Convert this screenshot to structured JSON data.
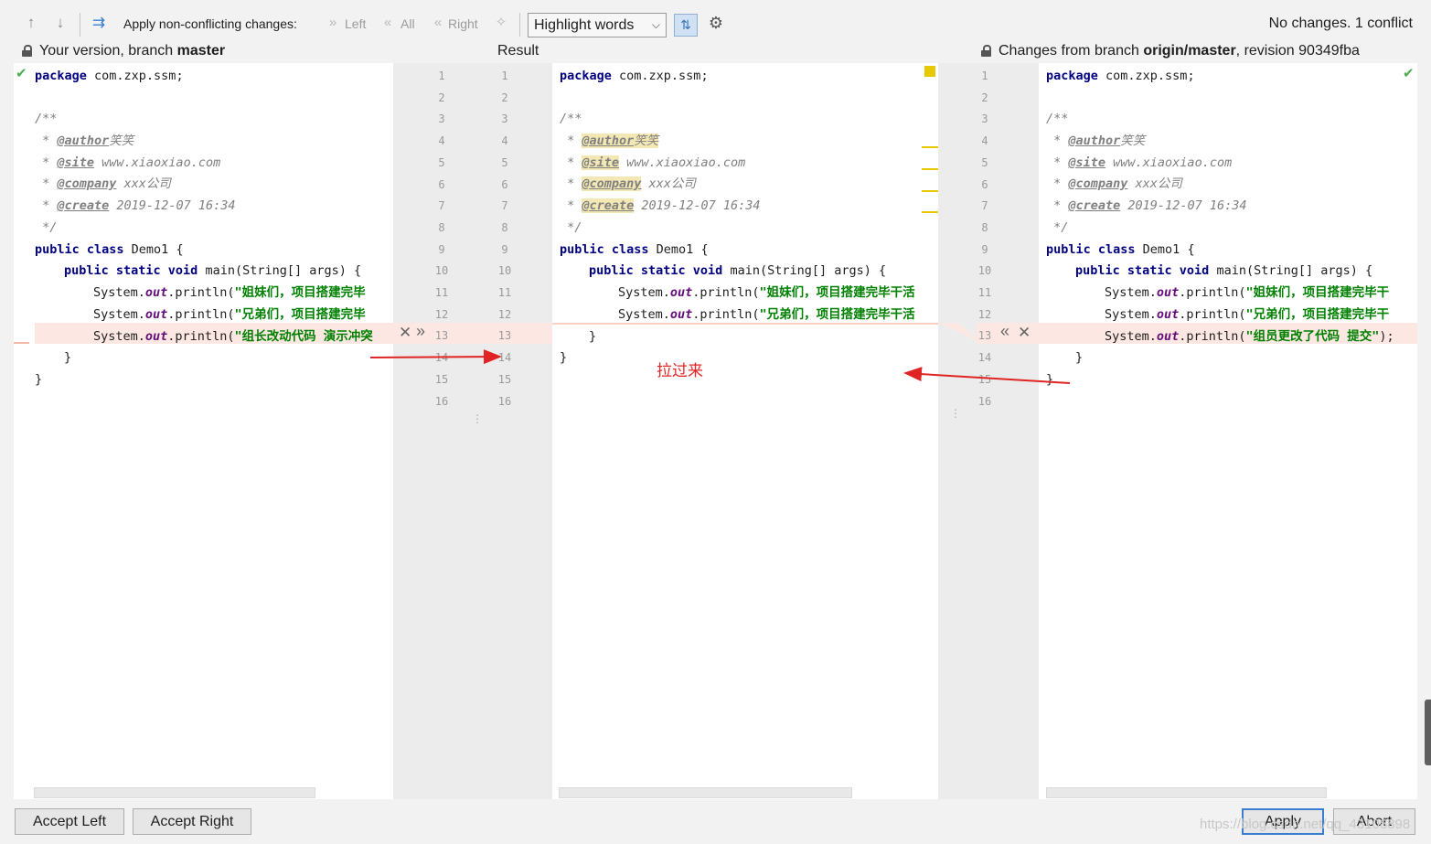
{
  "toolbar": {
    "apply_label": "Apply non-conflicting changes:",
    "left_label": "Left",
    "all_label": "All",
    "right_label": "Right",
    "highlight_mode": "Highlight words",
    "status": "No changes. 1 conflict"
  },
  "headers": {
    "left_prefix": "Your version, branch ",
    "left_branch": "master",
    "center": "Result",
    "right_prefix": "Changes from branch ",
    "right_branch": "origin/master",
    "right_suffix": ", revision 90349fba"
  },
  "line_numbers": {
    "left": [
      "1",
      "2",
      "3",
      "4",
      "5",
      "6",
      "7",
      "8",
      "9",
      "10",
      "11",
      "12",
      "13",
      "14",
      "15",
      "16"
    ],
    "result_left": [
      "1",
      "2",
      "3",
      "4",
      "5",
      "6",
      "7",
      "8",
      "9",
      "10",
      "11",
      "12",
      "13",
      "14",
      "15",
      "16"
    ],
    "result_right": [
      "1",
      "2",
      "3",
      "4",
      "5",
      "6",
      "7",
      "8",
      "9",
      "10",
      "11",
      "12",
      "13",
      "14",
      "15"
    ],
    "right": [
      "1",
      "2",
      "3",
      "4",
      "5",
      "6",
      "7",
      "8",
      "9",
      "10",
      "11",
      "12",
      "13",
      "14",
      "15",
      "16"
    ]
  },
  "code": {
    "package_kw": "package",
    "package_name": " com.zxp.ssm;",
    "doc_open": "/**",
    "doc_star": " * ",
    "doc_close": " */",
    "author_tag": "@author",
    "author_val": "笑笑",
    "site_tag": "@site",
    "site_val": " www.xiaoxiao.com",
    "company_tag": "@company",
    "company_val": " xxx公司",
    "create_tag": "@create",
    "create_val": " 2019-12-07 16:34",
    "class_kw": "public class",
    "class_name": " Demo1 {",
    "main_kw": "public static void",
    "main_sig": " main(String[] args) {",
    "sys": "System.",
    "out": "out",
    "println": ".println(",
    "str1_left": "\"姐妹们，项目搭建完毕",
    "str2_left": "\"兄弟们，项目搭建完毕",
    "str3_left": "\"组长改动代码 演示冲突",
    "str1_result": "\"姐妹们，项目搭建完毕干活",
    "str2_result": "\"兄弟们，项目搭建完毕干活",
    "str1_right": "\"姐妹们，项目搭建完毕干",
    "str2_right": "\"兄弟们，项目搭建完毕干",
    "str3_right": "\"组员更改了代码 提交\"",
    "str3_right_end": ");",
    "close_inner": "}",
    "close_outer": "}"
  },
  "annotation": "拉过来",
  "buttons": {
    "accept_left": "Accept Left",
    "accept_right": "Accept Right",
    "apply": "Apply",
    "abort": "Abort"
  },
  "watermark": "https://blog.csdn.net/qq_43108898",
  "colors": {
    "conflict": "#fde7e3",
    "marker": "#e8c800",
    "arrow": "#e02424",
    "accept_check": "#4caf50"
  }
}
